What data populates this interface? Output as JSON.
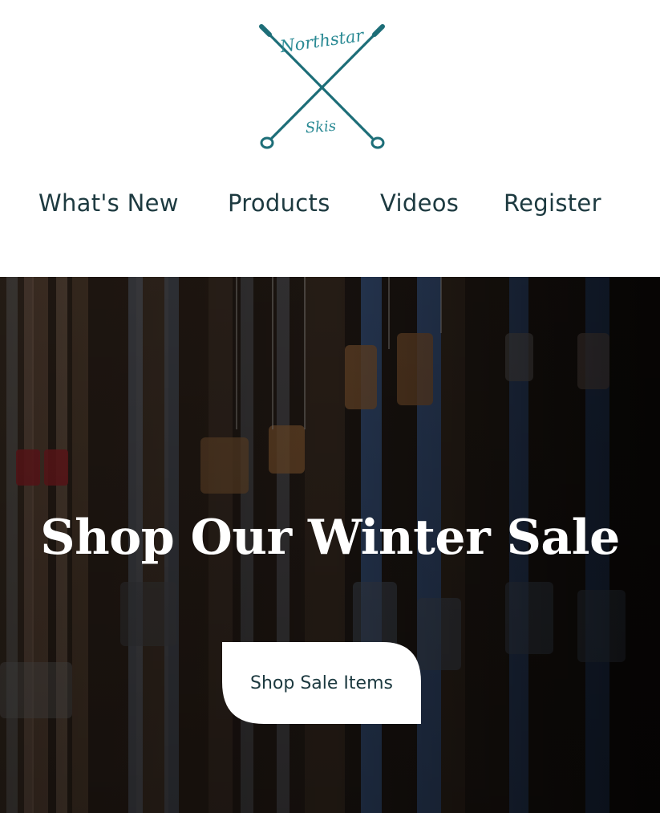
{
  "brand": {
    "logo_text_top": "Northstar",
    "logo_text_bottom": "Skis",
    "color": "#2a8a94"
  },
  "nav": {
    "items": [
      {
        "label": "What's New"
      },
      {
        "label": "Products"
      },
      {
        "label": "Videos"
      },
      {
        "label": "Register"
      }
    ],
    "text_color": "#1d3a40"
  },
  "hero": {
    "title": "Shop Our Winter Sale",
    "button_label": "Shop Sale Items",
    "background": "dark photo of skis in a rack"
  }
}
